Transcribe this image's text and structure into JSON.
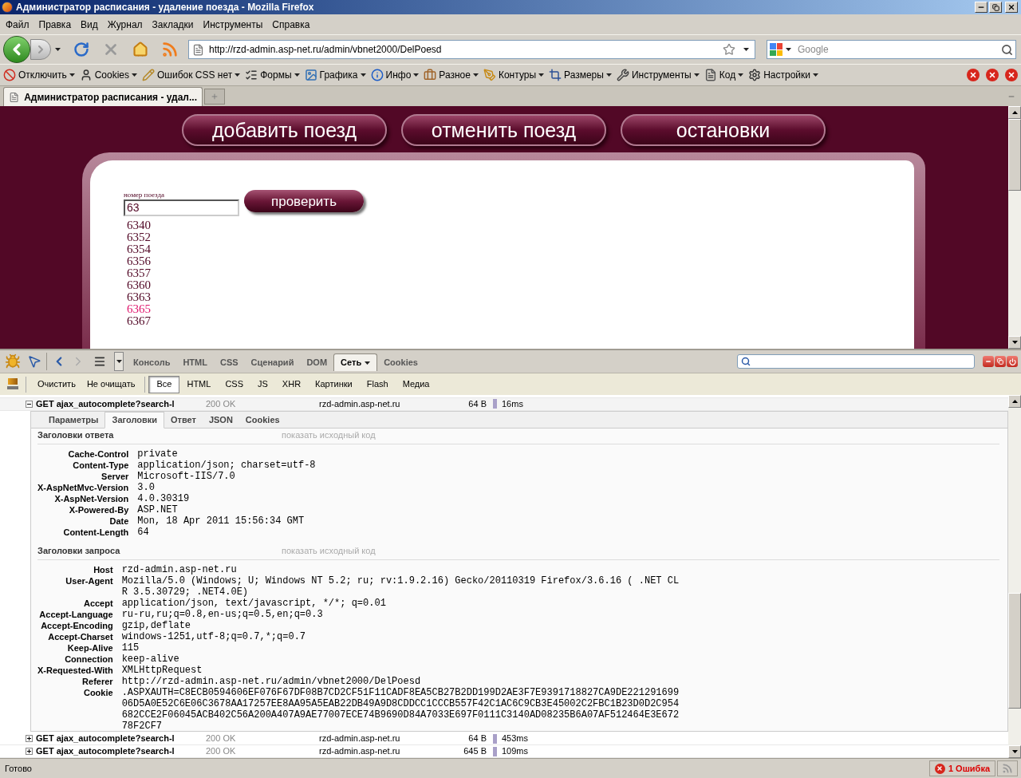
{
  "window": {
    "title": "Администратор расписания - удаление поезда - Mozilla Firefox"
  },
  "menu": [
    "Файл",
    "Правка",
    "Вид",
    "Журнал",
    "Закладки",
    "Инструменты",
    "Справка"
  ],
  "navigation": {
    "url": "http://rzd-admin.asp-net.ru/admin/vbnet2000/DelPoesd",
    "search_placeholder": "Google"
  },
  "webdev_toolbar": [
    {
      "kind": "ban",
      "label": "Отключить"
    },
    {
      "kind": "user",
      "label": "Cookies"
    },
    {
      "kind": "pencil",
      "label": "Ошибок CSS нет"
    },
    {
      "kind": "list",
      "label": "Формы"
    },
    {
      "kind": "image",
      "label": "Графика"
    },
    {
      "kind": "info",
      "label": "Инфо"
    },
    {
      "kind": "briefcase",
      "label": "Разное"
    },
    {
      "kind": "pen",
      "label": "Контуры"
    },
    {
      "kind": "crop",
      "label": "Размеры"
    },
    {
      "kind": "wrench",
      "label": "Инструменты"
    },
    {
      "kind": "file",
      "label": "Код"
    },
    {
      "kind": "settings",
      "label": "Настройки"
    }
  ],
  "tabs": [
    {
      "label": "Администратор расписания - удал...",
      "selected": true
    }
  ],
  "page": {
    "nav_buttons": [
      "добавить поезд",
      "отменить поезд",
      "остановки"
    ],
    "field_label": "номер поезда",
    "field_value": "63",
    "check_button": "проверить",
    "suggestions": [
      {
        "text": "6340",
        "selected": false
      },
      {
        "text": "6352",
        "selected": false
      },
      {
        "text": "6354",
        "selected": false
      },
      {
        "text": "6356",
        "selected": false
      },
      {
        "text": "6357",
        "selected": false
      },
      {
        "text": "6360",
        "selected": false
      },
      {
        "text": "6363",
        "selected": false
      },
      {
        "text": "6365",
        "selected": true
      },
      {
        "text": "6367",
        "selected": false
      }
    ]
  },
  "firebug": {
    "tabs": [
      {
        "label": "Консоль",
        "selected": false,
        "dropdown": false
      },
      {
        "label": "HTML",
        "selected": false,
        "dropdown": false
      },
      {
        "label": "CSS",
        "selected": false,
        "dropdown": false
      },
      {
        "label": "Сценарий",
        "selected": false,
        "dropdown": false
      },
      {
        "label": "DOM",
        "selected": false,
        "dropdown": false
      },
      {
        "label": "Сеть",
        "selected": true,
        "dropdown": true
      },
      {
        "label": "Cookies",
        "selected": false,
        "dropdown": false
      }
    ],
    "actions": [
      "Очистить",
      "Не очищать"
    ],
    "filters": [
      {
        "label": "Все",
        "selected": true
      },
      {
        "label": "HTML",
        "selected": false
      },
      {
        "label": "CSS",
        "selected": false
      },
      {
        "label": "JS",
        "selected": false
      },
      {
        "label": "XHR",
        "selected": false
      },
      {
        "label": "Картинки",
        "selected": false
      },
      {
        "label": "Flash",
        "selected": false
      },
      {
        "label": "Медиа",
        "selected": false
      }
    ],
    "requests": [
      {
        "expanded": true,
        "url": "GET ajax_autocomplete?search-l",
        "status": "200 OK",
        "domain": "rzd-admin.asp-net.ru",
        "size": "64 B",
        "time": "16ms"
      },
      {
        "expanded": false,
        "url": "GET ajax_autocomplete?search-l",
        "status": "200 OK",
        "domain": "rzd-admin.asp-net.ru",
        "size": "64 B",
        "time": "453ms"
      },
      {
        "expanded": false,
        "url": "GET ajax_autocomplete?search-l",
        "status": "200 OK",
        "domain": "rzd-admin.asp-net.ru",
        "size": "645 B",
        "time": "109ms"
      }
    ],
    "detail_tabs": [
      {
        "label": "Параметры",
        "selected": false
      },
      {
        "label": "Заголовки",
        "selected": true
      },
      {
        "label": "Ответ",
        "selected": false
      },
      {
        "label": "JSON",
        "selected": false
      },
      {
        "label": "Cookies",
        "selected": false
      }
    ],
    "sections": [
      {
        "title": "Заголовки ответа",
        "link": "показать исходный код",
        "headers": [
          {
            "name": "Cache-Control",
            "value": "private"
          },
          {
            "name": "Content-Type",
            "value": "application/json; charset=utf-8"
          },
          {
            "name": "Server",
            "value": "Microsoft-IIS/7.0"
          },
          {
            "name": "X-AspNetMvc-Version",
            "value": "3.0"
          },
          {
            "name": "X-AspNet-Version",
            "value": "4.0.30319"
          },
          {
            "name": "X-Powered-By",
            "value": "ASP.NET"
          },
          {
            "name": "Date",
            "value": "Mon, 18 Apr 2011 15:56:34 GMT"
          },
          {
            "name": "Content-Length",
            "value": "64"
          }
        ]
      },
      {
        "title": "Заголовки запроса",
        "link": "показать исходный код",
        "headers": [
          {
            "name": "Host",
            "value": "rzd-admin.asp-net.ru"
          },
          {
            "name": "User-Agent",
            "value": "Mozilla/5.0 (Windows; U; Windows NT 5.2; ru; rv:1.9.2.16) Gecko/20110319 Firefox/3.6.16 ( .NET CLR 3.5.30729; .NET4.0E)"
          },
          {
            "name": "Accept",
            "value": "application/json, text/javascript, */*; q=0.01"
          },
          {
            "name": "Accept-Language",
            "value": "ru-ru,ru;q=0.8,en-us;q=0.5,en;q=0.3"
          },
          {
            "name": "Accept-Encoding",
            "value": "gzip,deflate"
          },
          {
            "name": "Accept-Charset",
            "value": "windows-1251,utf-8;q=0.7,*;q=0.7"
          },
          {
            "name": "Keep-Alive",
            "value": "115"
          },
          {
            "name": "Connection",
            "value": "keep-alive"
          },
          {
            "name": "X-Requested-With",
            "value": "XMLHttpRequest"
          },
          {
            "name": "Referer",
            "value": "http://rzd-admin.asp-net.ru/admin/vbnet2000/DelPoesd"
          },
          {
            "name": "Cookie",
            "value": ".ASPXAUTH=C8ECB0594606EF076F67DF08B7CD2CF51F11CADF8EA5CB27B2DD199D2AE3F7E9391718827CA9DE22129169906D5A0E52C6E06C3678AA17257EE8AA95A5EAB22DB49A9D8CDDCC1CCCB557F42C1AC6C9CB3E45002C2FBC1B23D0D2C954682CCE2F06045ACB402C56A200A407A9AE77007ECE74B9690D84A7033E697F0111C3140AD08235B6A07AF512464E3E67278F2CF7"
          }
        ]
      }
    ]
  },
  "status_bar": {
    "text": "Готово",
    "errors": "1 Ошибка"
  }
}
